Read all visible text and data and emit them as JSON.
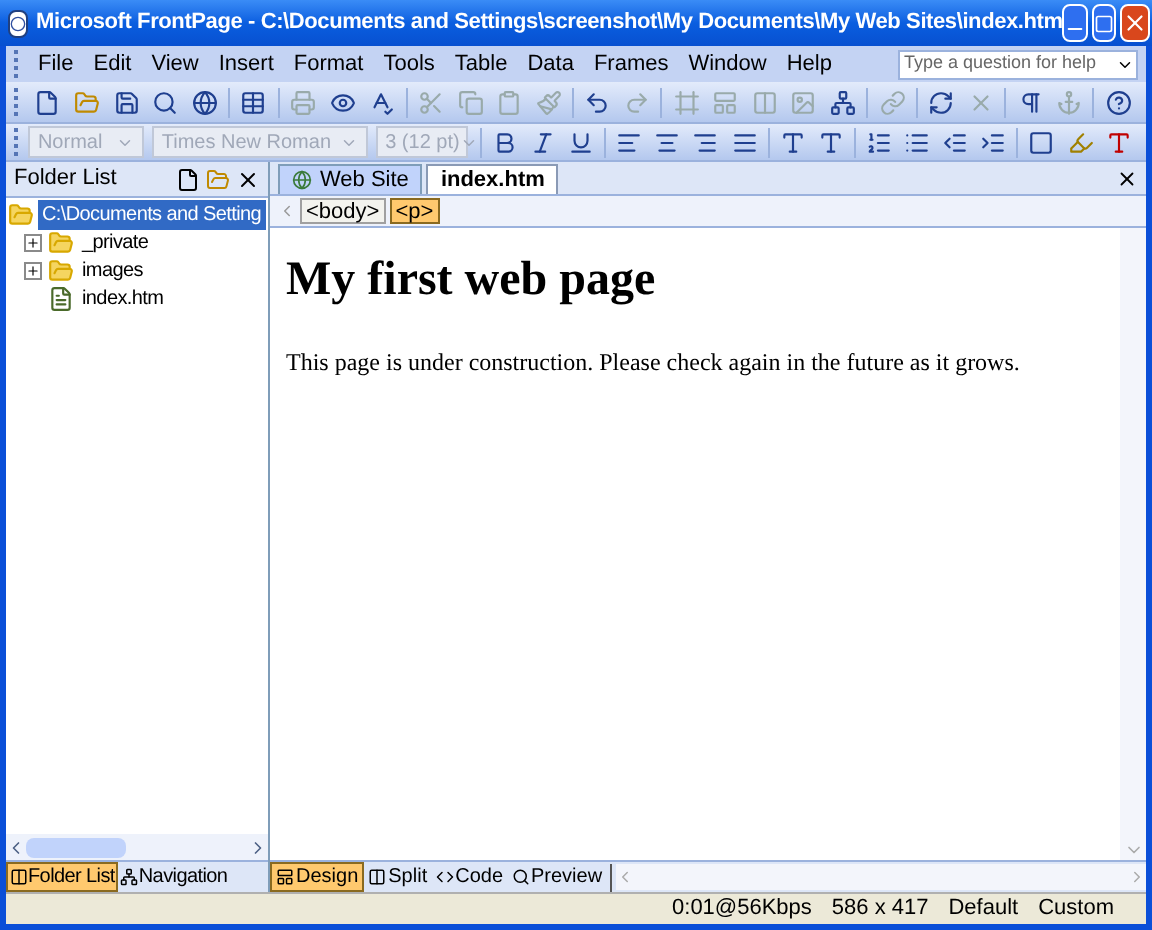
{
  "window": {
    "title": "Microsoft FrontPage - C:\\Documents and Settings\\screenshot\\My Documents\\My Web Sites\\index.htm"
  },
  "menu": [
    "File",
    "Edit",
    "View",
    "Insert",
    "Format",
    "Tools",
    "Table",
    "Data",
    "Frames",
    "Window",
    "Help"
  ],
  "help_search": {
    "placeholder": "Type a question for help"
  },
  "format_toolbar": {
    "style": {
      "value": "Normal",
      "disabled": true
    },
    "font": {
      "value": "Times New Roman",
      "disabled": true
    },
    "size": {
      "value": "3 (12 pt)",
      "disabled": true
    }
  },
  "folder_list": {
    "title": "Folder List",
    "tree": [
      {
        "label": "C:\\Documents and Setting",
        "selected": true,
        "kind": "folder",
        "children": [
          {
            "label": "_private",
            "selected": false,
            "kind": "folder",
            "expanded": false
          },
          {
            "label": "images",
            "selected": false,
            "kind": "folder",
            "expanded": false
          },
          {
            "label": "index.htm",
            "selected": false,
            "kind": "page"
          }
        ]
      }
    ]
  },
  "doc_tabs": [
    {
      "label": "Web Site",
      "selected": false
    },
    {
      "label": "index.htm",
      "selected": true
    }
  ],
  "tag_selector": [
    {
      "label": "<body>",
      "selected": false
    },
    {
      "label": "<p>",
      "selected": true
    }
  ],
  "document": {
    "heading": "My first web page",
    "paragraph": "This page is under construction. Please check again in the future as it grows."
  },
  "panel_views": [
    {
      "label": "Folder List",
      "selected": true
    },
    {
      "label": "Navigation",
      "selected": false
    }
  ],
  "page_views": [
    {
      "label": "Design",
      "selected": true
    },
    {
      "label": "Split",
      "selected": false
    },
    {
      "label": "Code",
      "selected": false
    },
    {
      "label": "Preview",
      "selected": false
    }
  ],
  "status_bar": [
    "0:01@56Kbps",
    "586 x 417",
    "Default",
    "Custom"
  ]
}
